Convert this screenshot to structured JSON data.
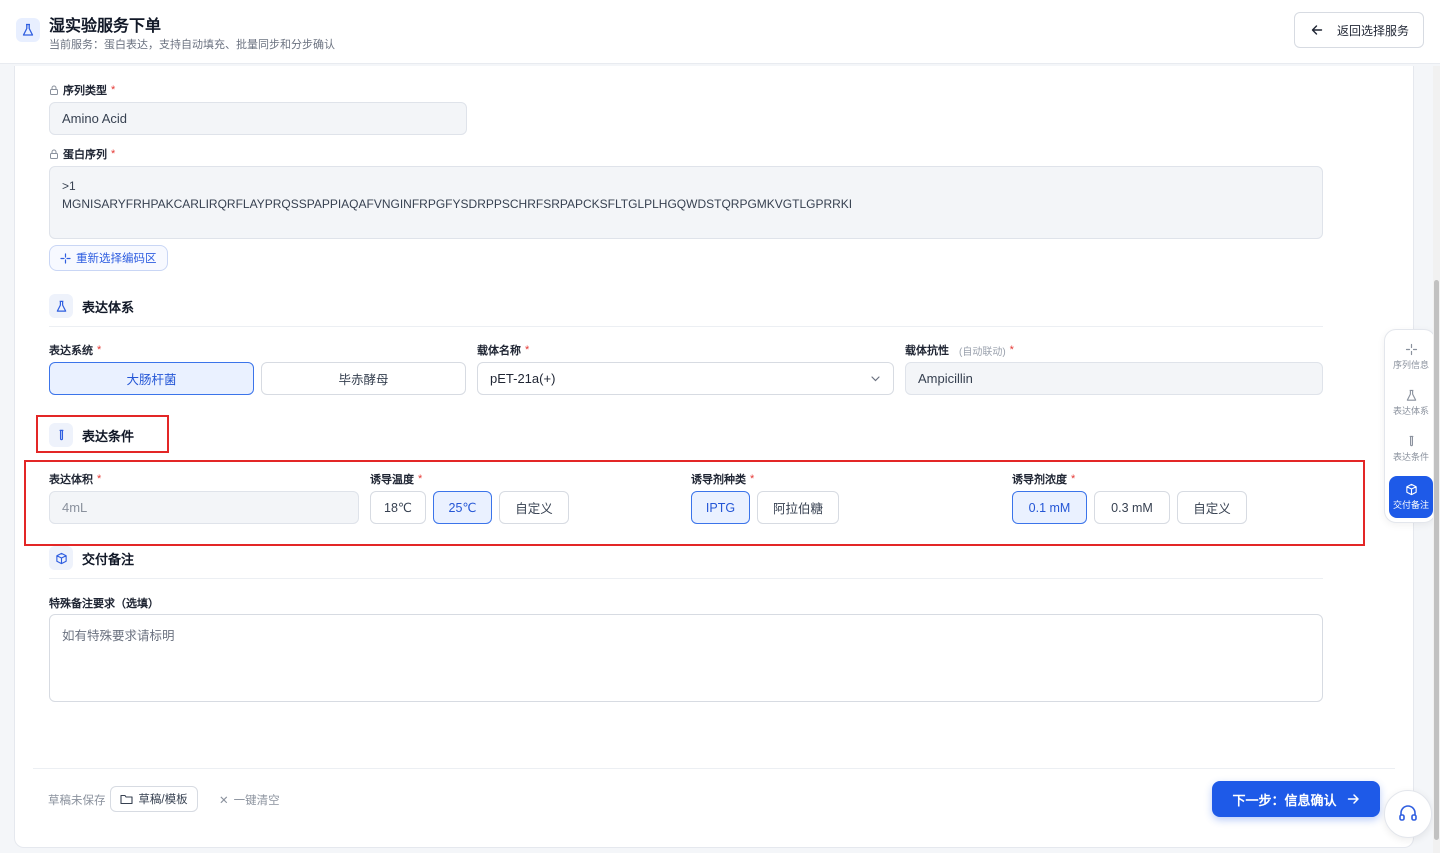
{
  "header": {
    "title": "湿实验服务下单",
    "subtitle": "当前服务：蛋白表达，支持自动填充、批量同步和分步确认",
    "back_label": "返回选择服务"
  },
  "sequence": {
    "type_label": "序列类型",
    "type_value": "Amino Acid",
    "seq_label": "蛋白序列",
    "seq_line1": ">1",
    "seq_line2": "MGNISARYFRHPAKCARLIRQRFLAYPRQSSPAPPIAQAFVNGINFRPGFYSDRPPSCHRFSRPAPCKSFLTGLPLHGQWDSTQRPGMKVGTLGPRRKI",
    "reselect_label": "重新选择编码区"
  },
  "expression_system": {
    "section_title": "表达体系",
    "system_label": "表达系统",
    "system_options": [
      "大肠杆菌",
      "毕赤酵母"
    ],
    "selected_system": "大肠杆菌",
    "vector_label": "载体名称",
    "vector_value": "pET-21a(+)",
    "resistance_label": "载体抗性",
    "resistance_hint": "(自动联动)",
    "resistance_value": "Ampicillin"
  },
  "conditions": {
    "section_title": "表达条件",
    "volume_label": "表达体积",
    "volume_value": "4mL",
    "temp_label": "诱导温度",
    "temp_options": [
      "18℃",
      "25℃",
      "自定义"
    ],
    "selected_temp": "25℃",
    "inducer_label": "诱导剂种类",
    "inducer_options": [
      "IPTG",
      "阿拉伯糖"
    ],
    "selected_inducer": "IPTG",
    "conc_label": "诱导剂浓度",
    "conc_options": [
      "0.1 mM",
      "0.3 mM",
      "自定义"
    ],
    "selected_conc": "0.1 mM"
  },
  "delivery": {
    "section_title": "交付备注",
    "notes_label": "特殊备注要求（选填）",
    "notes_placeholder": "如有特殊要求请标明"
  },
  "footer": {
    "draft_status": "草稿未保存",
    "draft_button": "草稿/模板",
    "clear_button": "一键清空",
    "next_button": "下一步：信息确认"
  },
  "sidenav": {
    "items": [
      "序列信息",
      "表达体系",
      "表达条件",
      "交付备注"
    ],
    "active": "交付备注"
  },
  "colors": {
    "primary": "#1e5ae8",
    "selected_bg": "#eaf1ff",
    "required": "#e53935",
    "highlight_box": "#e32626"
  }
}
